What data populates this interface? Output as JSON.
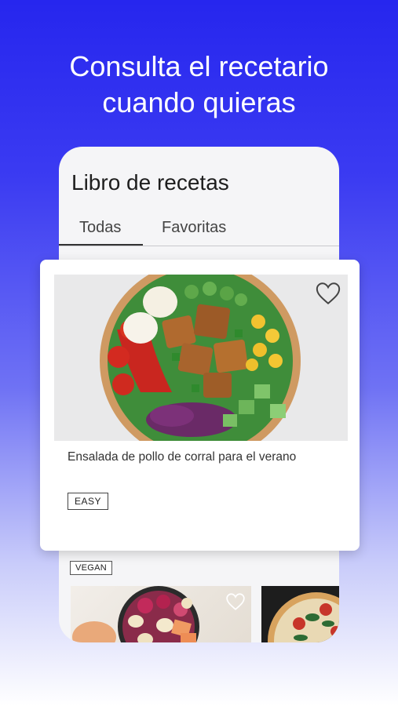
{
  "headline": {
    "line1": "Consulta el recetario",
    "line2": "cuando quieras"
  },
  "app": {
    "title": "Libro de recetas",
    "tabs": [
      {
        "label": "Todas",
        "active": true
      },
      {
        "label": "Favoritas",
        "active": false
      }
    ]
  },
  "featured_recipe": {
    "title": "Ensalada de pollo de corral para el verano",
    "difficulty": "EASY",
    "image": "chicken-salad-bowl-photo",
    "favorite_icon": "heart-outline-icon"
  },
  "next_row": {
    "badge": "VEGAN",
    "images": [
      "fruit-bowl-photo",
      "pizza-photo"
    ],
    "favorite_icon": "heart-outline-icon"
  },
  "colors": {
    "gradient_top": "#2626ee",
    "gradient_bottom": "#ffffff",
    "card_bg": "#ffffff",
    "text_dark": "#1e1e1e"
  }
}
